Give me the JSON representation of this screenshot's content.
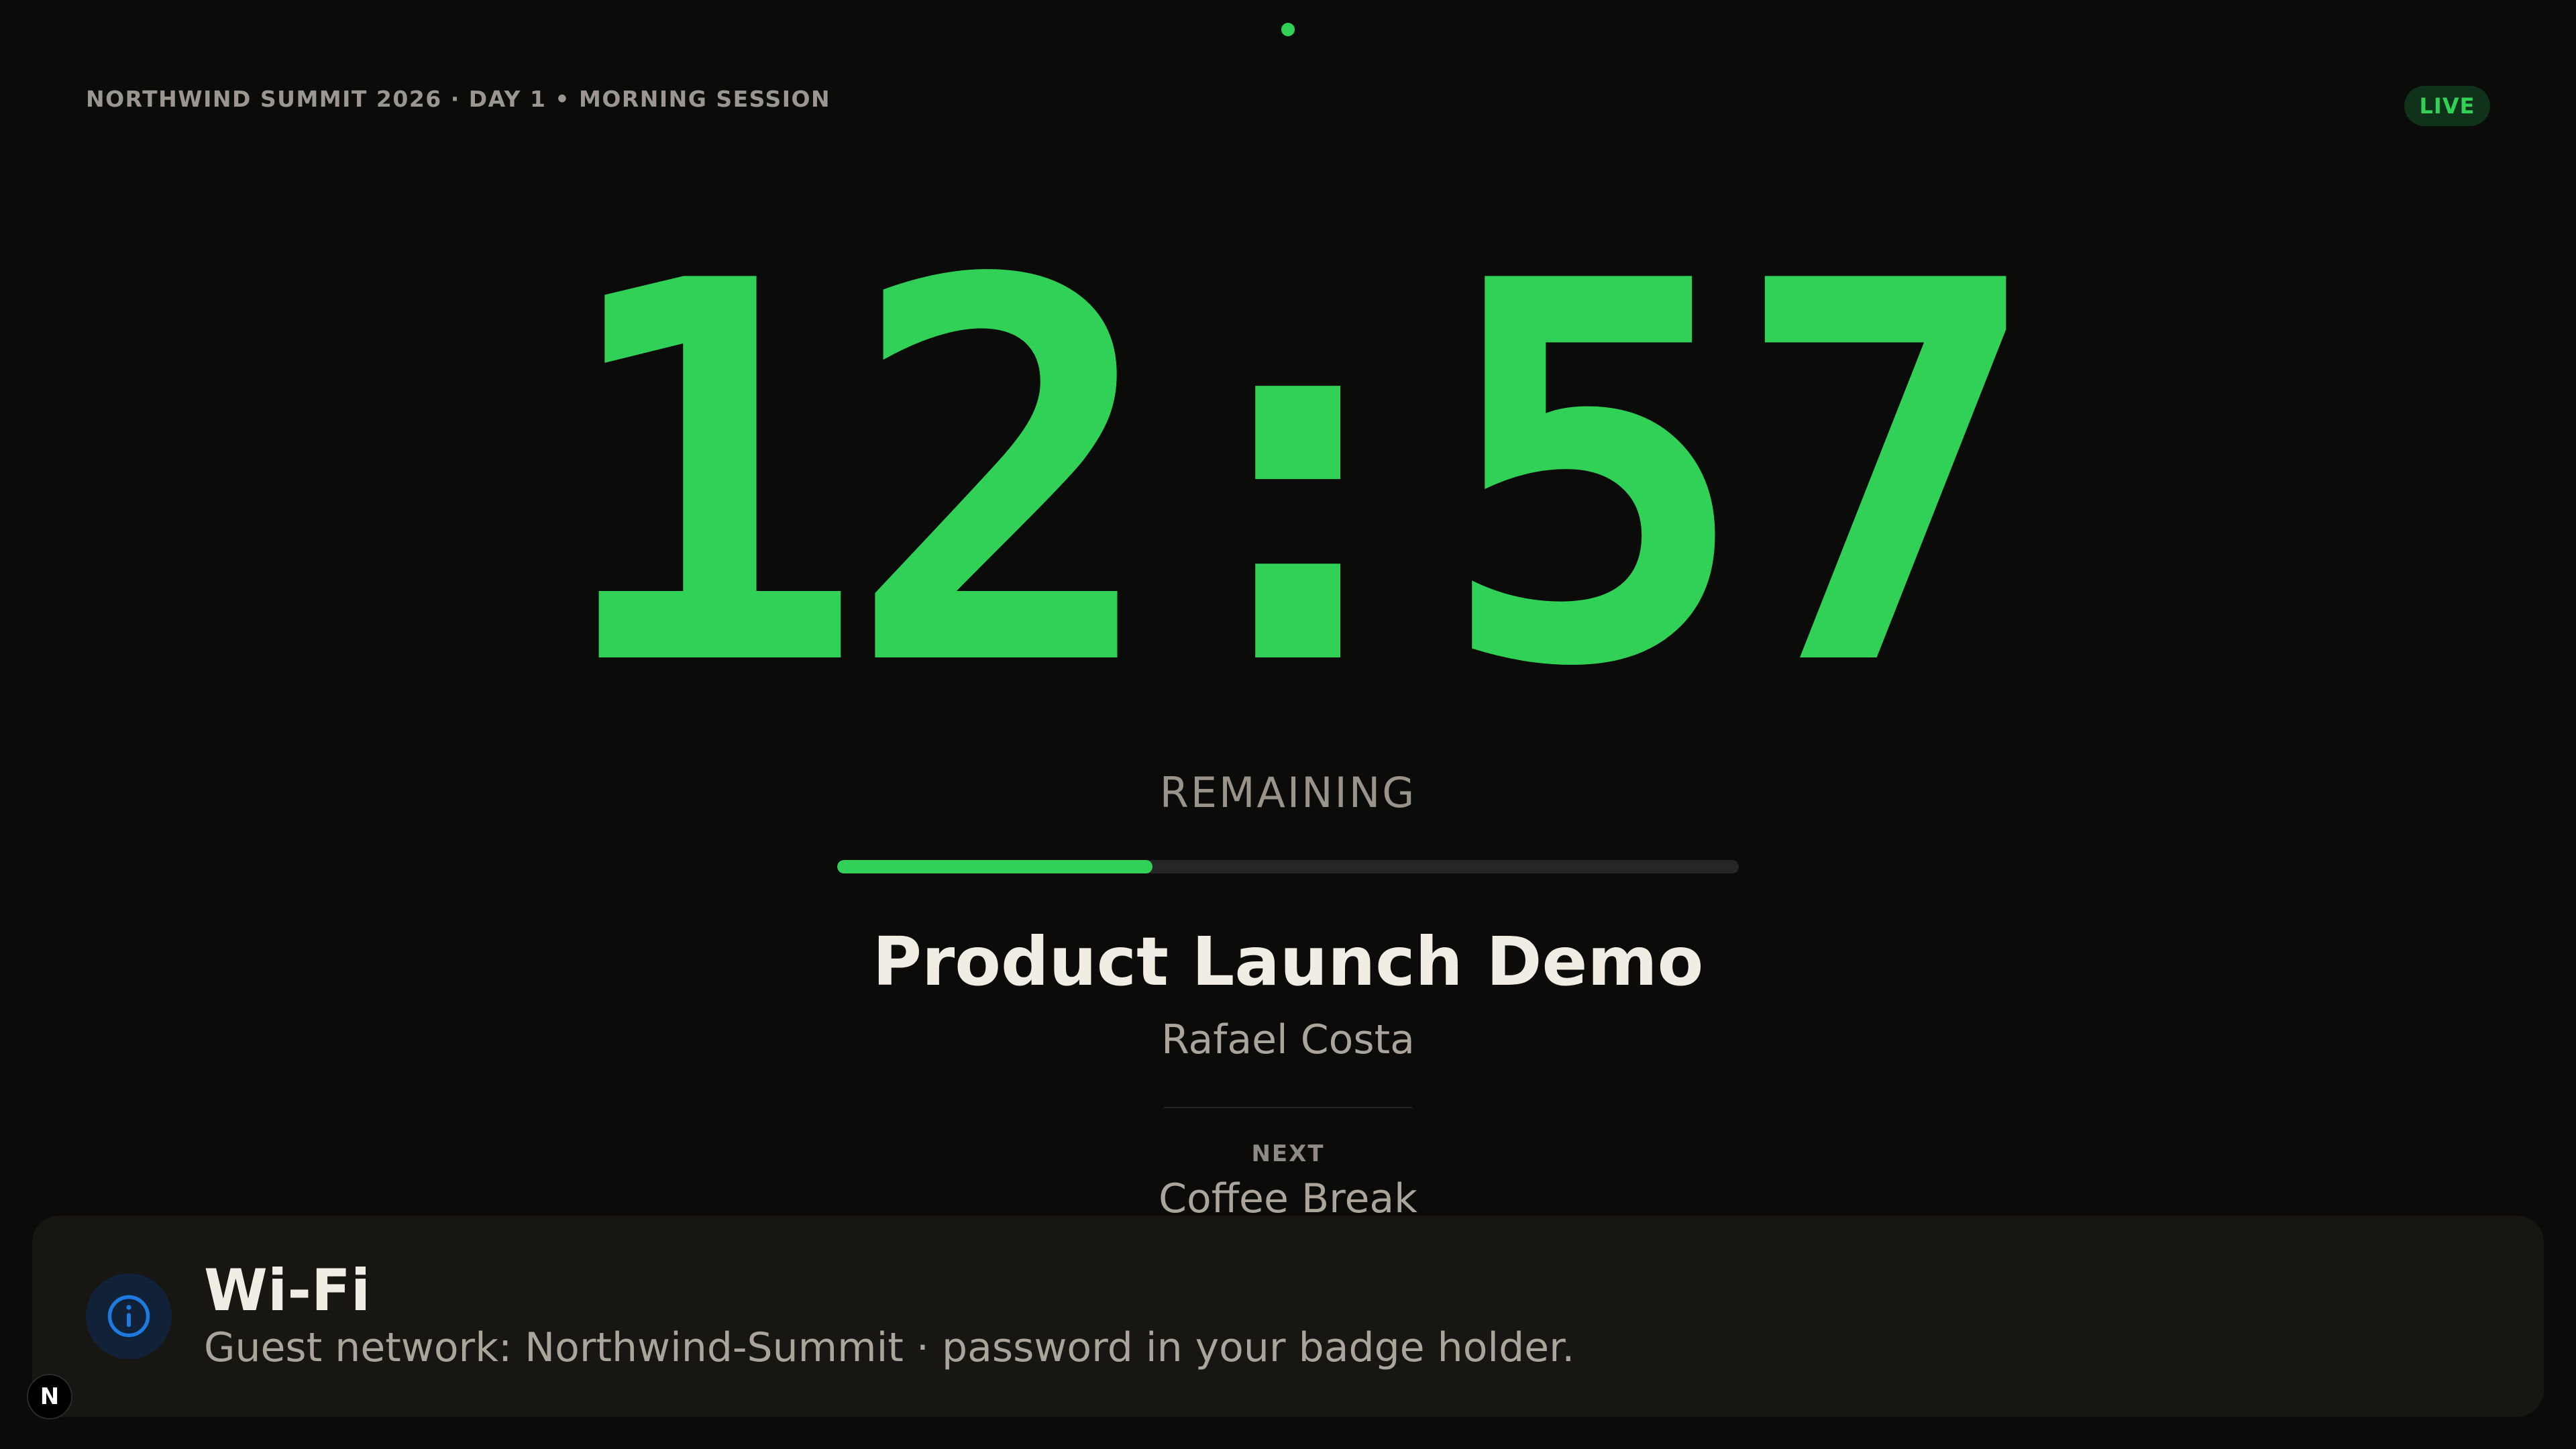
{
  "header": {
    "session_label": "NORTHWIND SUMMIT 2026 · DAY 1 • MORNING SESSION",
    "live_badge": "LIVE"
  },
  "timer": {
    "display": "12:57",
    "label": "REMAINING",
    "progress_fraction": 0.35
  },
  "current_session": {
    "title": "Product Launch Demo",
    "speaker": "Rafael Costa"
  },
  "next_session": {
    "label": "NEXT",
    "title": "Coffee Break"
  },
  "announcement": {
    "icon": "info-icon",
    "title": "Wi-Fi",
    "body": "Guest network: Northwind-Summit · password in your badge holder."
  },
  "corner_badge": {
    "letter": "N"
  },
  "colors": {
    "background": "#0b0b0a",
    "accent": "#31d158",
    "live_badge_bg": "#10321a",
    "announcement_bg": "#181612",
    "info_icon": "#1f7ae0",
    "title_text": "#f1ede4",
    "muted_text": "#aaa49a"
  }
}
